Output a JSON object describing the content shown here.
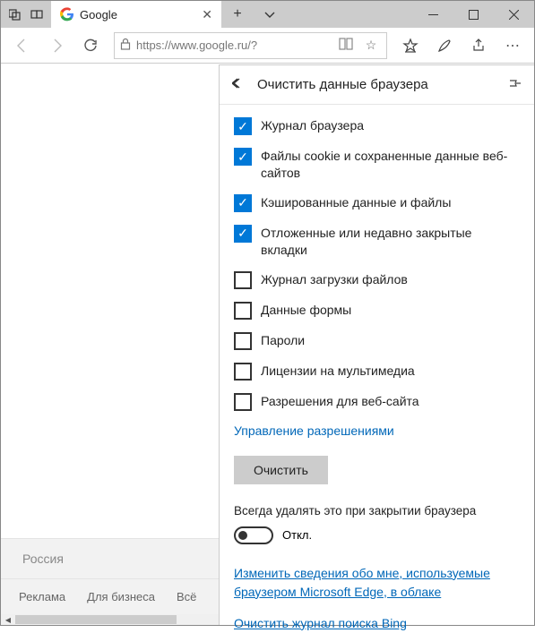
{
  "window": {
    "tab_title": "Google",
    "url": "https://www.google.ru/?"
  },
  "page": {
    "country": "Россия",
    "links": [
      "Реклама",
      "Для бизнеса",
      "Всё"
    ]
  },
  "panel": {
    "title": "Очистить данные браузера",
    "options": [
      {
        "label": "Журнал браузера",
        "checked": true
      },
      {
        "label": "Файлы cookie и сохраненные данные веб-сайтов",
        "checked": true
      },
      {
        "label": "Кэшированные данные и файлы",
        "checked": true
      },
      {
        "label": "Отложенные или недавно закрытые вкладки",
        "checked": true
      },
      {
        "label": "Журнал загрузки файлов",
        "checked": false
      },
      {
        "label": "Данные формы",
        "checked": false
      },
      {
        "label": "Пароли",
        "checked": false
      },
      {
        "label": "Лицензии на мультимедиа",
        "checked": false
      },
      {
        "label": "Разрешения для веб-сайта",
        "checked": false
      }
    ],
    "manage_link": "Управление разрешениями",
    "clear_button": "Очистить",
    "always_text": "Всегда удалять это при закрытии браузера",
    "toggle_label": "Откл.",
    "bottom_link": "Изменить сведения обо мне, используемые браузером Microsoft Edge, в облаке",
    "truncated_link": "Очистить журнал поиска Bing"
  }
}
